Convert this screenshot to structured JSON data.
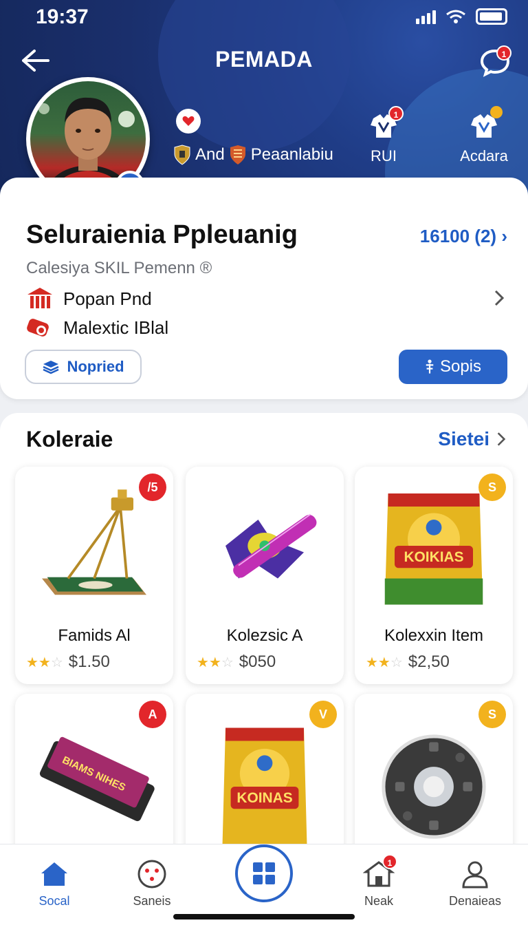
{
  "status": {
    "time": "19:37"
  },
  "header": {
    "title": "PEMADA",
    "notification_count": "1"
  },
  "player": {
    "team_text": "And",
    "club_text": "Peaanlabiu",
    "stat_left_label": "RUI",
    "stat_left_badge": "1",
    "stat_right_label": "Acdara"
  },
  "profile": {
    "name": "Seluraienia Ppleuanig",
    "points": "16100 (2)",
    "subtitle": "Calesiya SKIL Pemenn ®",
    "row1": "Popan Pnd",
    "row2": "Malextic IBlal",
    "btn_outline": "Nopried",
    "btn_primary": "Sopis"
  },
  "collection": {
    "title": "Koleraie",
    "see_all": "Sietei",
    "items": [
      {
        "name": "Famids Al",
        "price": "$1.50",
        "rating": 3,
        "badge": "/5",
        "badge_color": "#e2262b"
      },
      {
        "name": "Kolezsic A",
        "price": "$050",
        "rating": 3,
        "badge": "",
        "badge_color": ""
      },
      {
        "name": "Kolexxin Item",
        "price": "$2,50",
        "rating": 3,
        "badge": "S",
        "badge_color": "#f2b21d"
      },
      {
        "name": "",
        "price": "",
        "rating": 0,
        "badge": "A",
        "badge_color": "#e2262b"
      },
      {
        "name": "",
        "price": "",
        "rating": 0,
        "badge": "V",
        "badge_color": "#f2b21d"
      },
      {
        "name": "",
        "price": "",
        "rating": 0,
        "badge": "S",
        "badge_color": "#f2b21d"
      }
    ],
    "snack_label": "KOIKIAS",
    "snack_label2": "KOINAS",
    "bar_label": "BIAMS NIHES"
  },
  "tabs": [
    {
      "label": "Socal",
      "active": true
    },
    {
      "label": "Saneis",
      "active": false
    },
    {
      "label": "Neak",
      "active": false,
      "badge": "1"
    },
    {
      "label": "Denaieas",
      "active": false
    }
  ],
  "colors": {
    "primary": "#2a64c8",
    "header": "#1a2f6c",
    "badge_red": "#e2262b",
    "badge_yellow": "#f2b21d"
  }
}
